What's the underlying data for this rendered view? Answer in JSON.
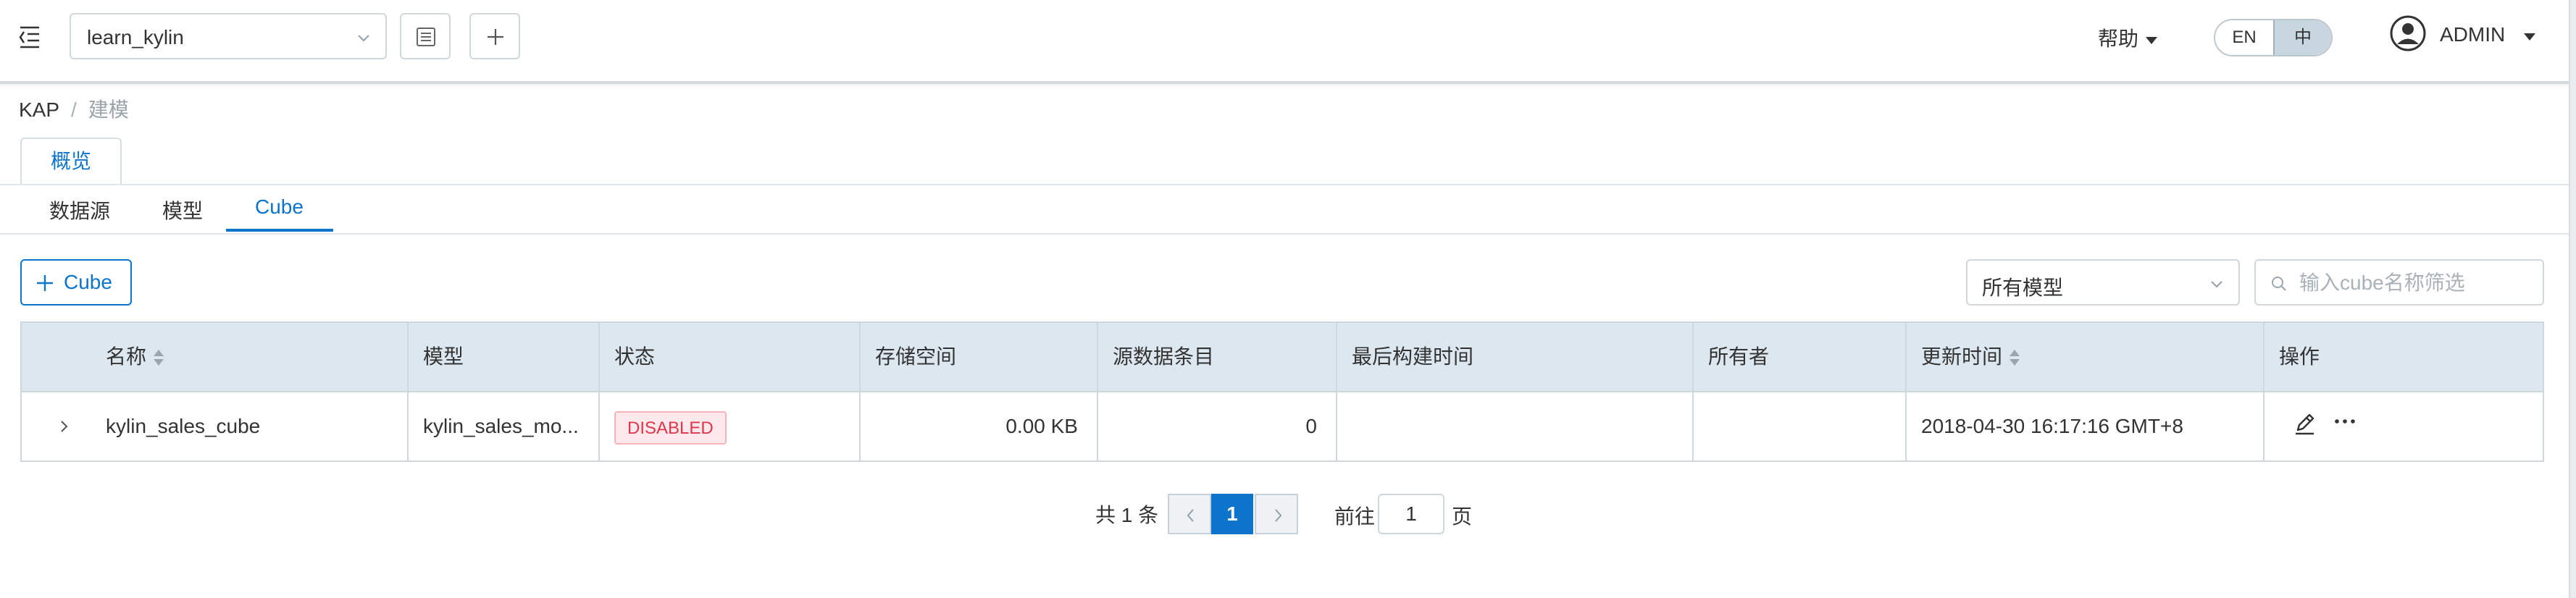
{
  "header": {
    "project": "learn_kylin",
    "help_label": "帮助",
    "lang_en": "EN",
    "lang_zh": "中",
    "user_name": "ADMIN"
  },
  "breadcrumb": {
    "root": "KAP",
    "separator": "/",
    "current": "建模"
  },
  "tabs": {
    "main": "概览"
  },
  "subtabs": [
    "数据源",
    "模型",
    "Cube"
  ],
  "toolbar": {
    "add_label": "Cube",
    "model_filter": "所有模型",
    "search_placeholder": "输入cube名称筛选"
  },
  "table": {
    "columns": [
      "名称",
      "模型",
      "状态",
      "存储空间",
      "源数据条目",
      "最后构建时间",
      "所有者",
      "更新时间",
      "操作"
    ],
    "rows": [
      {
        "name": "kylin_sales_cube",
        "model": "kylin_sales_mo...",
        "status": "DISABLED",
        "storage": "0.00 KB",
        "source_records": "0",
        "last_build": "",
        "owner": "",
        "updated": "2018-04-30 16:17:16 GMT+8"
      }
    ]
  },
  "pagination": {
    "total_prefix": "共",
    "total": "1",
    "total_suffix": "条",
    "current_page": "1",
    "goto_label": "前往",
    "goto_value": "1",
    "goto_suffix": "页"
  },
  "colors": {
    "accent": "#0d74cc",
    "header_bg": "#dce7ef",
    "disabled_badge": "#e0354a"
  }
}
